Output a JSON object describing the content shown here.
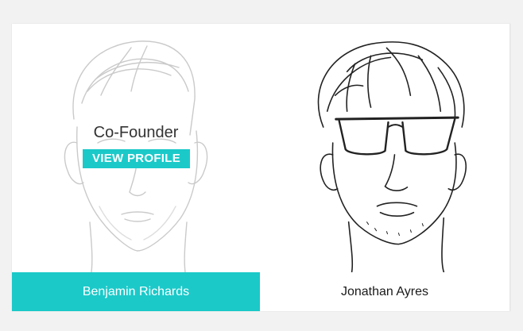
{
  "team": {
    "members": [
      {
        "name": "Benjamin Richards",
        "role": "Co-Founder",
        "action_label": "VIEW PROFILE",
        "photo_icon": "sketch-portrait-man-short-hair"
      },
      {
        "name": "Jonathan Ayres",
        "photo_icon": "sketch-portrait-man-sunglasses"
      }
    ]
  },
  "colors": {
    "accent": "#1bc9c9",
    "background": "#f2f2f2",
    "card": "#ffffff"
  }
}
